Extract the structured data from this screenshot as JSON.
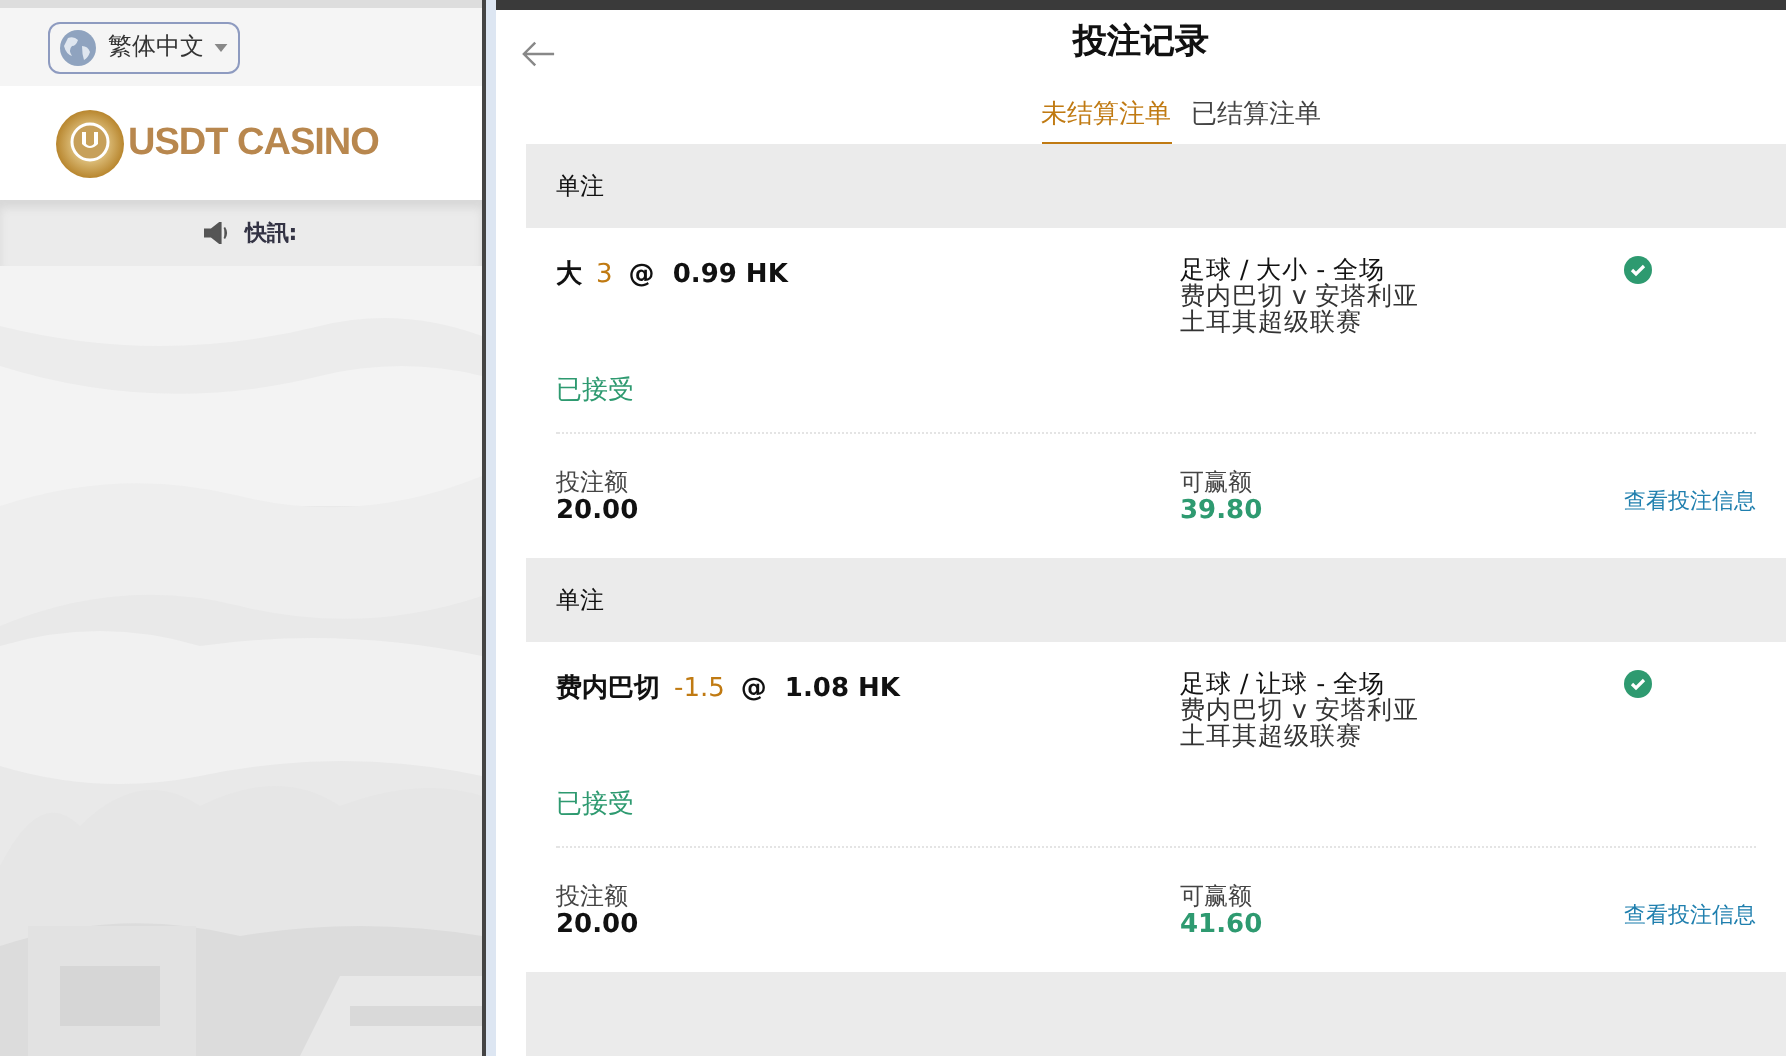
{
  "language": {
    "label": "繁体中文"
  },
  "logo": {
    "text": "USDT CASINO"
  },
  "ticker": {
    "label": "快訊:"
  },
  "panel": {
    "title": "投注记录",
    "tabs": [
      {
        "label": "未结算注单",
        "selected": true
      },
      {
        "label": "已结算注单",
        "selected": false
      }
    ],
    "bets": [
      {
        "type": "单注",
        "selection": "大",
        "handicap": "3",
        "odds": "@  0.99 HK",
        "market": "足球 / 大小 - 全场",
        "match": "费内巴切 v 安塔利亚",
        "league": "土耳其超级联赛",
        "accepted": true,
        "status": "已接受",
        "stake_label": "投注额",
        "stake": "20.00",
        "win_label": "可赢额",
        "win": "39.80",
        "link": "查看投注信息"
      },
      {
        "type": "单注",
        "selection": "费内巴切",
        "handicap": "-1.5",
        "odds": "@  1.08 HK",
        "market": "足球 / 让球 - 全场",
        "match": "费内巴切 v 安塔利亚",
        "league": "土耳其超级联赛",
        "accepted": true,
        "status": "已接受",
        "stake_label": "投注额",
        "stake": "20.00",
        "win_label": "可赢额",
        "win": "41.60",
        "link": "查看投注信息"
      }
    ]
  }
}
